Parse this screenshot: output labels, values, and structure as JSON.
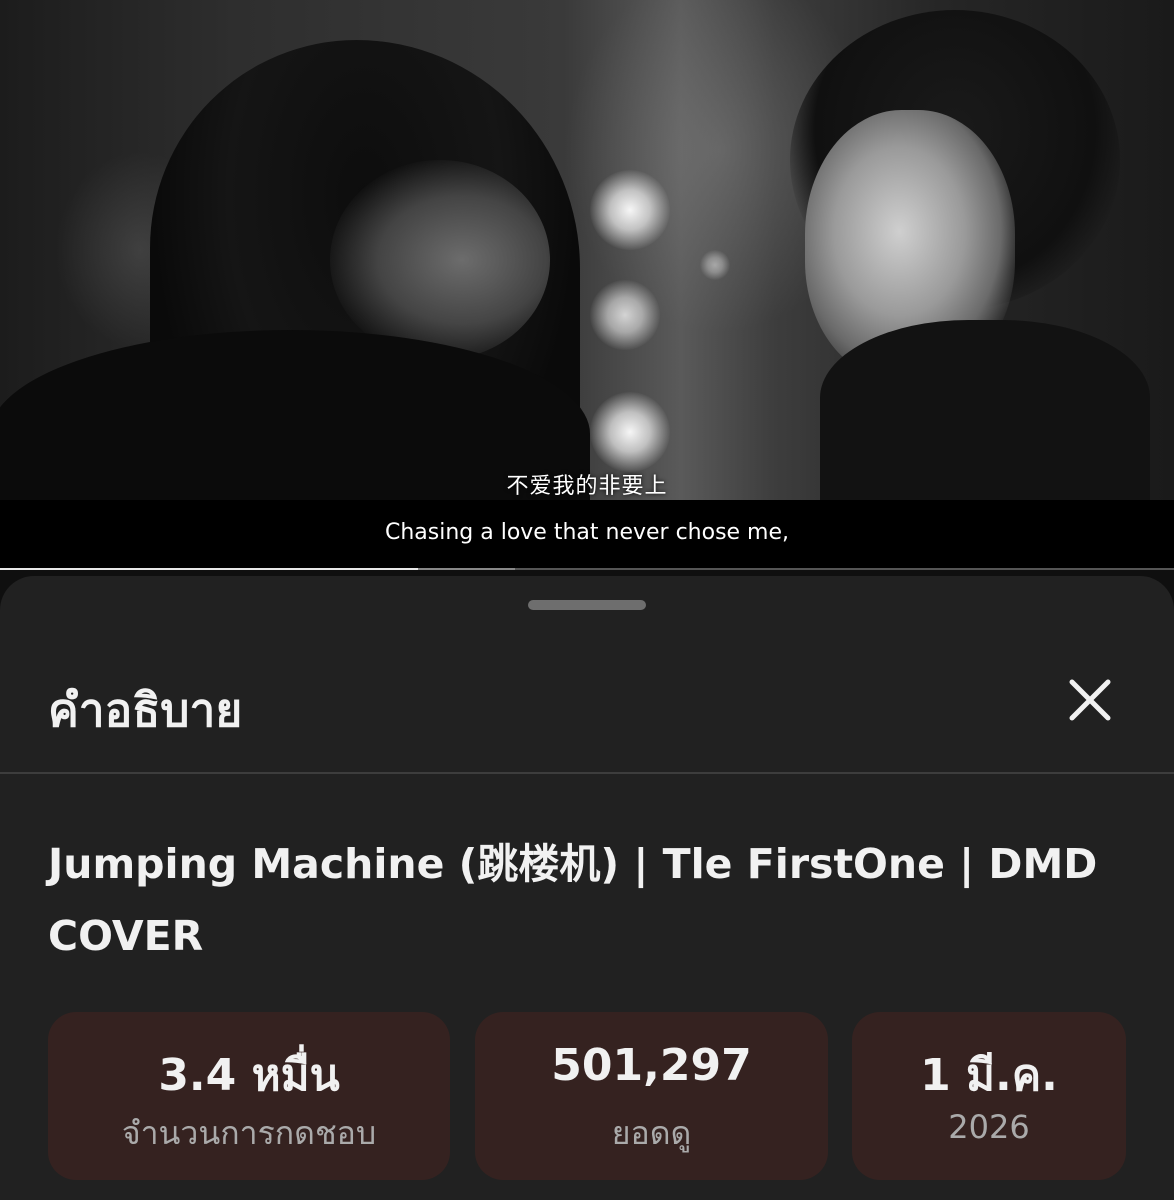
{
  "video": {
    "subtitle_chinese": "不爱我的非要上",
    "subtitle_english": "Chasing a love that never chose me,",
    "progress_fraction": 0.356,
    "buffered_fraction": 0.439
  },
  "description_panel": {
    "title": "คำอธิบาย",
    "close_icon": "close-icon",
    "video_title": "Jumping Machine (跳楼机) | Tle FirstOne | DMD COVER",
    "stats": [
      {
        "value": "3.4 หมื่น",
        "label": "จำนวนการกดชอบ"
      },
      {
        "value": "501,297",
        "label": "ยอดดู"
      },
      {
        "value": "1 มี.ค.",
        "label": "2026"
      }
    ]
  },
  "colors": {
    "sheet_background": "#212121",
    "stat_card_background": "#352220",
    "primary_text": "#f1f1f1",
    "secondary_text": "#aaaaaa"
  }
}
